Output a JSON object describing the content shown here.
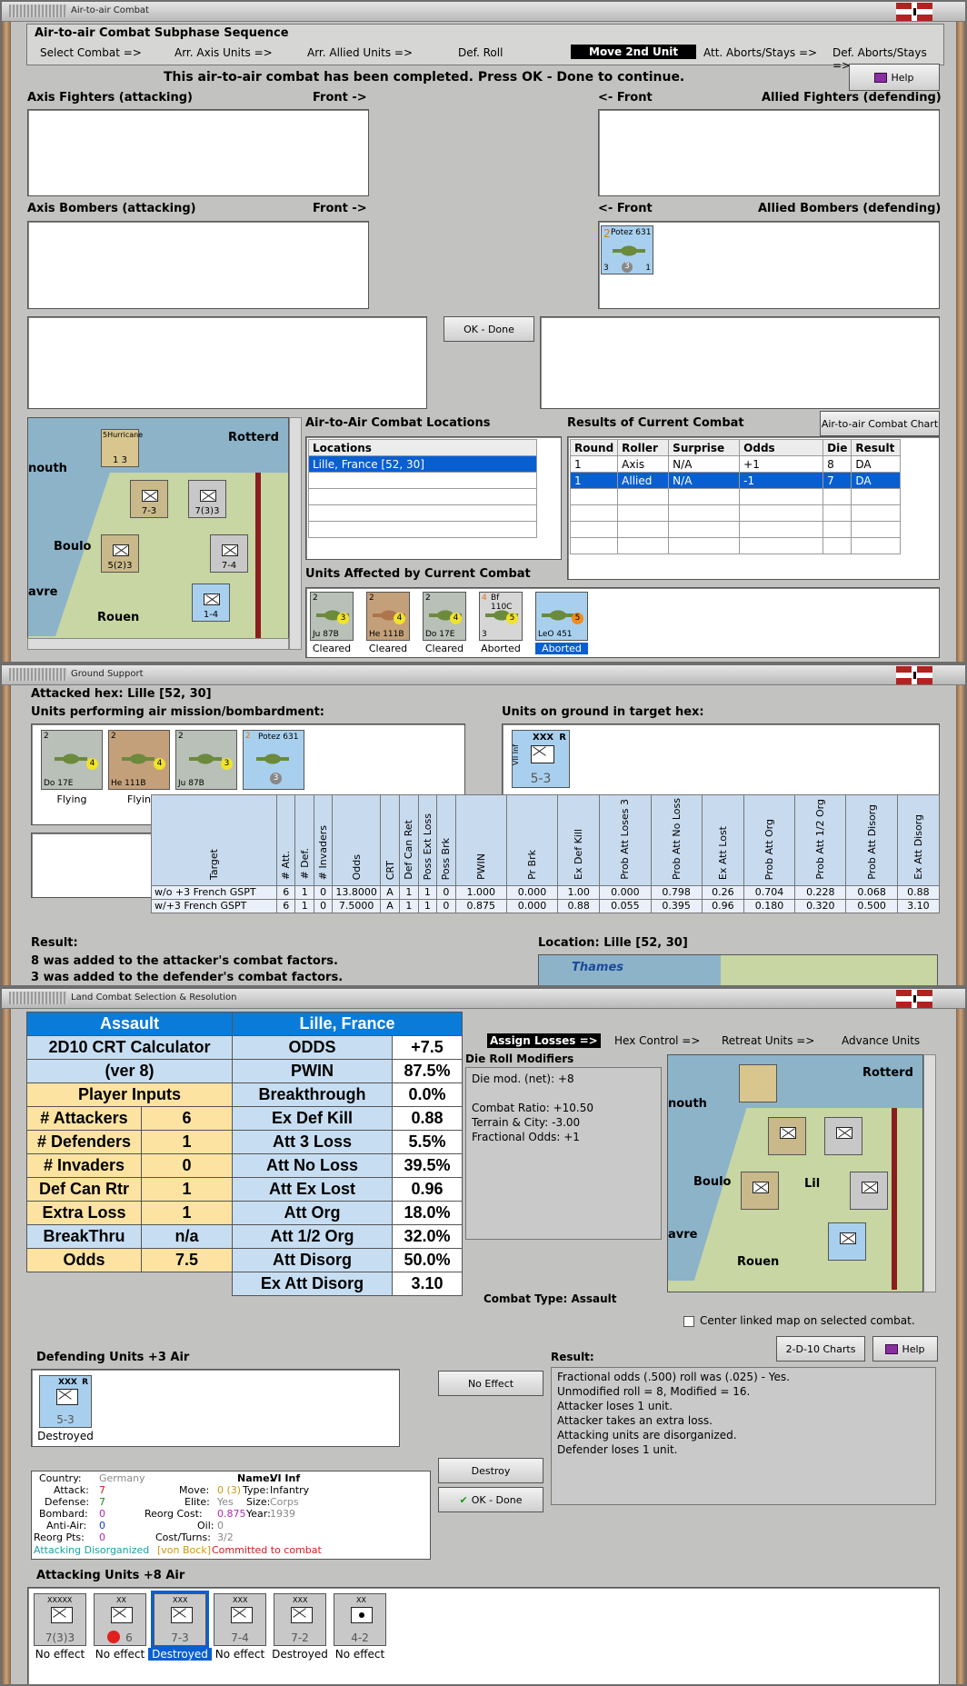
{
  "colors": {
    "accent": "#0b7bd9",
    "selection": "#0a5fd0",
    "sheet_header": "#0b7bd9",
    "sheet_lightblue": "#c7def2",
    "sheet_yellow": "#fce3a1"
  },
  "w1": {
    "title": "Air-to-air Combat",
    "sequence_title": "Air-to-air Combat Subphase Sequence",
    "steps": [
      "Select Combat =>",
      "Arr. Axis Units =>",
      "Arr. Allied Units =>",
      "Def. Roll",
      "Move 2nd Unit",
      "Att. Aborts/Stays =>",
      "Def. Aborts/Stays =>"
    ],
    "status": "This air-to-air combat has been completed.  Press OK - Done to continue.",
    "help": "Help",
    "axis_fighters": "Axis Fighters (attacking)",
    "axis_bombers": "Axis Bombers (attacking)",
    "front_right": "Front ->",
    "front_left": "<- Front",
    "allied_fighters": "Allied Fighters (defending)",
    "allied_bombers": "Allied Bombers (defending)",
    "ok_done": "OK - Done",
    "potez": {
      "att": "2",
      "name": "Potez 631",
      "p": "1",
      "a": "3",
      "b": "3",
      "c": "1"
    },
    "locations_title": "Air-to-Air Combat Locations",
    "locations_header": "Locations",
    "locations": [
      "Lille, France [52, 30]"
    ],
    "results_title": "Results of Current Combat",
    "chart_btn": "Air-to-air Combat Chart",
    "results_headers": [
      "Round",
      "Roller",
      "Surprise",
      "Odds",
      "Die",
      "Result"
    ],
    "results_rows": [
      [
        "1",
        "Axis",
        "N/A",
        "+1",
        "8",
        "DA"
      ],
      [
        "1",
        "Allied",
        "N/A",
        "-1",
        "7",
        "DA"
      ]
    ],
    "affected_title": "Units Affected by Current Combat",
    "affected": [
      {
        "top": "2",
        "left": "3",
        "name": "Ju 87B",
        "badge": "3",
        "status": "Cleared"
      },
      {
        "top": "2",
        "left": "2",
        "name": "He 111B",
        "badge": "4",
        "status": "Cleared"
      },
      {
        "top": "2",
        "left": "2",
        "name": "Do 17E",
        "badge": "4",
        "status": "Cleared"
      },
      {
        "top": "4",
        "left": "3",
        "name": "Bf 110C",
        "badge": "5",
        "status": "Aborted"
      },
      {
        "top": "",
        "left": "3",
        "name": "LeO 451",
        "badge": "5",
        "status": "Aborted"
      }
    ],
    "map_labels": {
      "rotterdam": "Rotterd",
      "mouth": "nouth",
      "boulogne": "Boulo",
      "havre": "avre",
      "rouen": "Rouen"
    },
    "map_counters": [
      {
        "label": "5Hurricane",
        "val": "1  3"
      },
      {
        "label": "XX",
        "val": "7-3"
      },
      {
        "label": "XXXX",
        "val": "7(3)3"
      },
      {
        "label": "XXXXX",
        "val": "5(2)3"
      },
      {
        "label": "XXX",
        "val": "7-4"
      },
      {
        "label": "XX",
        "val": "1-4"
      }
    ]
  },
  "w2": {
    "title": "Ground Support",
    "attacked": "Attacked hex: Lille  [52, 30]",
    "performing": "Units performing air mission/bombardment:",
    "on_ground": "Units on ground in target hex:",
    "air_units": [
      {
        "name": "Do 17E",
        "top": "2",
        "badge": "4",
        "status": "Flying"
      },
      {
        "name": "He 111B",
        "top": "2",
        "badge": "4",
        "status": "Flyin"
      },
      {
        "name": "Ju 87B",
        "top": "2",
        "badge": "3",
        "status": ""
      },
      {
        "name": "Potez 631",
        "top": "2",
        "badge": "3",
        "status": ""
      }
    ],
    "ground_unit": {
      "name": "VII Inf",
      "size": "XXX",
      "val": "5-3",
      "r": "R"
    },
    "table_headers": [
      "Target",
      "# Att.",
      "# Def.",
      "# Invaders",
      "Odds",
      "CRT",
      "Def Can Ret",
      "Poss Ext Loss",
      "Poss Brk",
      "PWIN",
      "Pr Brk",
      "Ex Def Kill",
      "Prob Att Loses 3",
      "Prob Att No Loss",
      "Ex Att Lost",
      "Prob Att Org",
      "Prob Att 1/2 Org",
      "Prob Att Disorg",
      "Ex Att Disorg"
    ],
    "table_rows": [
      [
        "w/o +3 French GSPT",
        "6",
        "1",
        "0",
        "13.8000",
        "A",
        "1",
        "1",
        "0",
        "1.000",
        "0.000",
        "1.00",
        "0.000",
        "0.798",
        "0.26",
        "0.704",
        "0.228",
        "0.068",
        "0.88"
      ],
      [
        "w/+3 French GSPT",
        "6",
        "1",
        "0",
        "7.5000",
        "A",
        "1",
        "1",
        "0",
        "0.875",
        "0.000",
        "0.88",
        "0.055",
        "0.395",
        "0.96",
        "0.180",
        "0.320",
        "0.500",
        "3.10"
      ]
    ],
    "result_label": "Result:",
    "result_lines": [
      "8 was added to the attacker's combat factors.",
      "3 was added to the defender's combat factors."
    ],
    "location": "Location:  Lille  [52, 30]",
    "map_label": "Thames"
  },
  "w3": {
    "title": "Land Combat Selection & Resolution",
    "sheet": {
      "left_header": "Assault",
      "right_header": "Lille, France",
      "calc_title": "2D10 CRT Calculator",
      "calc_ver": "(ver 8)",
      "player_inputs": "Player Inputs",
      "inputs": [
        [
          "# Attackers",
          "6"
        ],
        [
          "# Defenders",
          "1"
        ],
        [
          "# Invaders",
          "0"
        ],
        [
          "Def Can Rtr",
          "1"
        ],
        [
          "Extra Loss",
          "1"
        ],
        [
          "BreakThru",
          "n/a"
        ],
        [
          "Odds",
          "7.5"
        ]
      ],
      "outputs": [
        [
          "ODDS",
          "+7.5"
        ],
        [
          "PWIN",
          "87.5%"
        ],
        [
          "Breakthrough",
          "0.0%"
        ],
        [
          "Ex Def Kill",
          "0.88"
        ],
        [
          "Att 3 Loss",
          "5.5%"
        ],
        [
          "Att No Loss",
          "39.5%"
        ],
        [
          "Att Ex Lost",
          "0.96"
        ],
        [
          "Att Org",
          "18.0%"
        ],
        [
          "Att 1/2 Org",
          "32.0%"
        ],
        [
          "Att Disorg",
          "50.0%"
        ],
        [
          "Ex Att Disorg",
          "3.10"
        ]
      ]
    },
    "steps": [
      "Assign Losses =>",
      "Hex Control =>",
      "Retreat Units =>",
      "Advance Units"
    ],
    "dr_title": "Die Roll Modifiers",
    "dr_lines": [
      "Die mod. (net): +8",
      "",
      "Combat Ratio: +10.50",
      "Terrain & City: -3.00",
      "Fractional Odds: +1"
    ],
    "combat_type": "Combat Type:  Assault",
    "center_linked": "Center linked map on selected combat.",
    "charts_btn": "2-D-10 Charts",
    "help": "Help",
    "defending_title": "Defending Units +3 Air",
    "def_unit": {
      "name": "VII Inf",
      "size": "XXX",
      "val": "5-3",
      "r": "R",
      "status": "Destroyed"
    },
    "no_effect": "No Effect",
    "destroy": "Destroy",
    "ok_done": "OK - Done",
    "result_label": "Result:",
    "result_lines": [
      "Fractional odds (.500) roll was (.025)  - Yes.",
      "Unmodified roll = 8, Modified = 16.",
      "Attacker loses 1 unit.",
      "Attacker takes an extra loss.",
      "Attacking units are disorganized.",
      "Defender loses 1 unit."
    ],
    "info": {
      "country_k": "Country:",
      "country_v": "Germany",
      "attack_k": "Attack:",
      "attack_v": "7",
      "defense_k": "Defense:",
      "defense_v": "7",
      "bombard_k": "Bombard:",
      "bombard_v": "0",
      "aa_k": "Anti-Air:",
      "aa_v": "0",
      "reorg_k": "Reorg Pts:",
      "reorg_v": "0",
      "name_k": "Name:",
      "name_v": "VI Inf",
      "move_k": "Move:",
      "move_v": "0 (3)",
      "type_k": "Type:",
      "type_v": "Infantry",
      "elite_k": "Elite:",
      "elite_v": "Yes",
      "size_k": "Size:",
      "size_v": "Corps",
      "rcost_k": "Reorg Cost:",
      "rcost_v": "0.875",
      "year_k": "Year:",
      "year_v": "1939",
      "oil_k": "Oil:",
      "oil_v": "0",
      "cost_k": "Cost/Turns:",
      "cost_v": "3/2",
      "status1": "Attacking Disorganized",
      "status2": "[von Bock]",
      "status3": "Committed to combat"
    },
    "attacking_title": "Attacking Units +8 Air",
    "att_units": [
      {
        "top": "XXXXX",
        "val": "7(3)3",
        "status": "No effect"
      },
      {
        "top": "XX",
        "val": "6",
        "status": "No effect"
      },
      {
        "top": "XXX",
        "val": "7-3",
        "status": "Destroyed"
      },
      {
        "top": "XXX",
        "val": "7-4",
        "status": "No effect"
      },
      {
        "top": "XXX",
        "val": "7-2",
        "status": "Destroyed"
      },
      {
        "top": "XX",
        "val": "4-2",
        "status": "No effect"
      }
    ],
    "map_labels": {
      "rotterdam": "Rotterd",
      "mouth": "nouth",
      "boulogne": "Boulo",
      "havre": "avre",
      "rouen": "Rouen",
      "lille": "Lil"
    }
  }
}
